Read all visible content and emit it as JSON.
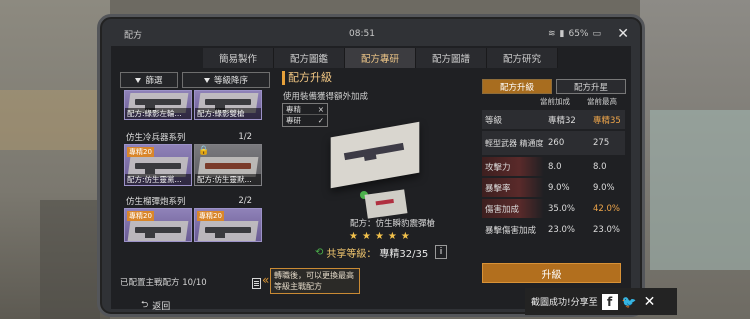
{
  "status": {
    "title": "配方",
    "time": "08:51",
    "battery": "65%"
  },
  "tabs": [
    {
      "label": "簡易製作",
      "active": false
    },
    {
      "label": "配方圖鑑",
      "active": false
    },
    {
      "label": "配方專研",
      "active": true
    },
    {
      "label": "配方圖譜",
      "active": false
    },
    {
      "label": "配方研究",
      "active": false
    }
  ],
  "filters": {
    "filter": "篩選",
    "sort": "等級降序"
  },
  "top_cards": [
    {
      "badge": "專精35",
      "caption": "配方:綠影左輪..."
    },
    {
      "badge": "專精35",
      "caption": "配方:綠影雙槍"
    }
  ],
  "groups": [
    {
      "name": "仿生冷兵器系列",
      "count": "1/2",
      "cards": [
        {
          "badge": "專精20",
          "caption": "配方:仿生靈黨...",
          "locked": false
        },
        {
          "badge": "",
          "caption": "配方:仿生靈默...",
          "locked": true
        }
      ]
    },
    {
      "name": "仿生榴彈炮系列",
      "count": "2/2",
      "cards": [
        {
          "badge": "專精20",
          "caption": ""
        },
        {
          "badge": "專精20",
          "caption": ""
        }
      ]
    }
  ],
  "left_footer": "已配置主戰配方 10/10",
  "hint": "轉職後，可以更換最高等級主戰配方",
  "back_label": "返回",
  "middle": {
    "title": "配方升級",
    "subtitle": "使用裝備獲得額外加成",
    "legend": [
      {
        "label": "專精",
        "mark": "×"
      },
      {
        "label": "專研",
        "mark": "✓"
      }
    ],
    "caption": "配方：仿生瞬豹震彈槍",
    "stars": [
      "★",
      "★",
      "★",
      "★",
      "★"
    ],
    "share_label": "共享等級：",
    "share_value": "專精32/35",
    "info": "i"
  },
  "right": {
    "tab_upgrade": "配方升級",
    "tab_star": "配方升星",
    "col_current": "當前加成",
    "col_max": "當前最高",
    "rows": [
      {
        "key": "等級",
        "cur": "專精32",
        "max": "專精35",
        "max_up": true
      },
      {
        "key": "輕型武器 精通度",
        "cur": "260",
        "max": "275",
        "max_up": false
      },
      {
        "key": "攻擊力",
        "cur": "8.0",
        "max": "8.0",
        "max_up": false
      },
      {
        "key": "暴擊率",
        "cur": "9.0%",
        "max": "9.0%",
        "max_up": false
      },
      {
        "key": "傷害加成",
        "cur": "35.0%",
        "max": "42.0%",
        "max_up": true
      },
      {
        "key": "暴擊傷害加成",
        "cur": "23.0%",
        "max": "23.0%",
        "max_up": false
      }
    ],
    "upgrade_label": "升級"
  },
  "toast": {
    "text": "截圖成功!分享至",
    "fb": "f",
    "tw": "🐦",
    "close": "✕"
  },
  "accent": "#b26f1e"
}
